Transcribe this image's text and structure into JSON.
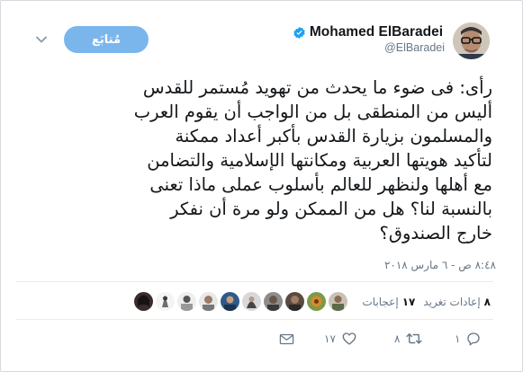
{
  "header": {
    "display_name": "Mohamed ElBaradei",
    "handle": "@ElBaradei",
    "follow_label": "مُتابَع",
    "verified_icon": "verified-badge-icon",
    "menu_icon": "chevron-down-icon"
  },
  "tweet": {
    "lines": [
      "رأى: فى ضوء ما يحدث من تهويد مُستمر للقدس",
      "أليس من المنطقى بل من الواجب أن يقوم العرب",
      "والمسلمون بزيارة القدس بأكبر أعداد ممكنة",
      "لتأكيد هويتها العربية ومكانتها الإسلامية والتضامن",
      "مع أهلها ولنظهر للعالم بأسلوب عملى ماذا تعنى",
      "بالنسبة لنا؟ هل من الممكن ولو مرة أن نفكر",
      "خارج الصندوق؟"
    ],
    "timestamp": "٨:٤٨ ص - ٦ مارس ٢٠١٨"
  },
  "stats": {
    "retweets_count": "٨",
    "retweets_label": "إعادات تغريد",
    "likes_count": "١٧",
    "likes_label": "إعجابات"
  },
  "actions": {
    "reply_count": "١",
    "retweet_count": "٨",
    "like_count": "١٧",
    "icons": [
      "reply-icon",
      "retweet-icon",
      "like-icon",
      "message-icon"
    ]
  },
  "colors": {
    "follow_button": "#7ab6ec",
    "verified": "#1da1f2",
    "secondary_text": "#657786",
    "primary_text": "#14171a"
  }
}
